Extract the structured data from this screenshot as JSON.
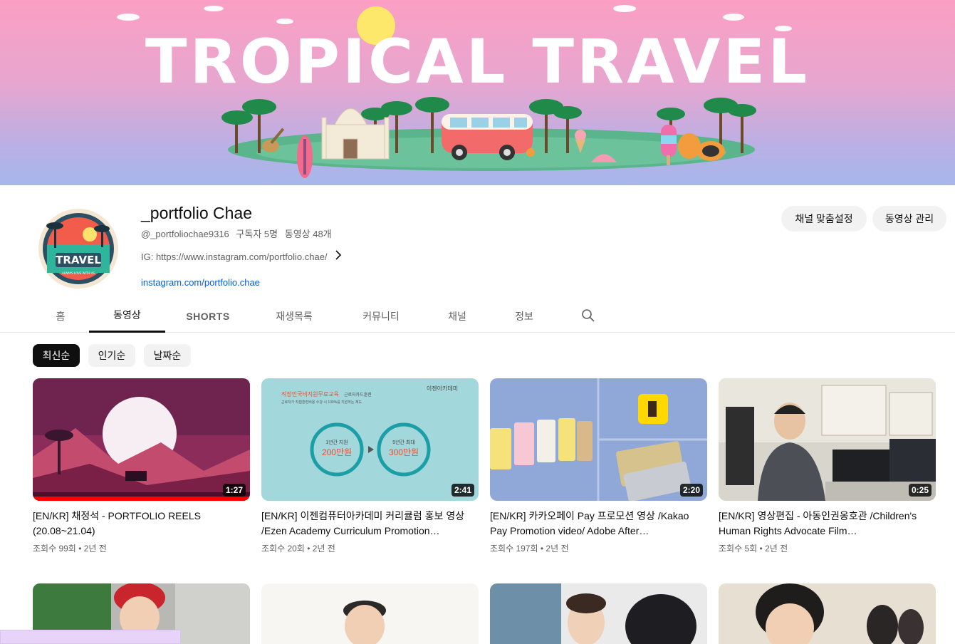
{
  "banner": {
    "title": "TROPICAL TRAVEL"
  },
  "channel": {
    "avatar_text": "TRAVEL",
    "avatar_subtext": "ALWAYS LOVE WITH US",
    "name": "_portfolio Chae",
    "handle": "@_portfoliochae9316",
    "subscribers": "구독자 5명",
    "video_count": "동영상 48개",
    "description": "IG: https://www.instagram.com/portfolio.chae/",
    "link": "instagram.com/portfolio.chae"
  },
  "header_buttons": {
    "customize": "채널 맞춤설정",
    "manage": "동영상 관리"
  },
  "tabs": [
    {
      "label": "홈"
    },
    {
      "label": "동영상"
    },
    {
      "label": "SHORTS"
    },
    {
      "label": "재생목록"
    },
    {
      "label": "커뮤니티"
    },
    {
      "label": "채널"
    },
    {
      "label": "정보"
    }
  ],
  "active_tab": "동영상",
  "chips": [
    {
      "label": "최신순"
    },
    {
      "label": "인기순"
    },
    {
      "label": "날짜순"
    }
  ],
  "videos": [
    {
      "title": "[EN/KR] 채정석 - PORTFOLIO REELS (20.08~21.04)",
      "duration": "1:27",
      "views": "조회수 99회",
      "age": "2년 전"
    },
    {
      "title": "[EN/KR] 이젠컴퓨터아카데미 커리큘럼 홍보 영상 /Ezen Academy Curriculum Promotion…",
      "duration": "2:41",
      "views": "조회수 20회",
      "age": "2년 전",
      "thumb_texts": {
        "brand": "이젠아카데미",
        "headline": "직장인국비지원무료교육",
        "tag": "근로자카드훈련",
        "sub": "근로자가 직접훈련비용 수강 시 100%를 지원하는 제도",
        "c1_top": "1년간 지원",
        "c1_amount": "200만원",
        "c2_top": "5년간 최대",
        "c2_amount": "300만원"
      }
    },
    {
      "title": "[EN/KR] 카카오페이 Pay 프로모션 영상 /Kakao Pay Promotion video/ Adobe After…",
      "duration": "2:20",
      "views": "조회수 197회",
      "age": "2년 전"
    },
    {
      "title": "[EN/KR] 영상편집 - 아동인권옹호관 /Children's Human Rights Advocate Film…",
      "duration": "0:25",
      "views": "조회수 5회",
      "age": "2년 전"
    }
  ],
  "colors": {
    "accent_link": "#065fd4",
    "chip_active_bg": "#0f0f0f",
    "chip_bg": "#f2f2f2",
    "meta_text": "#606060"
  }
}
